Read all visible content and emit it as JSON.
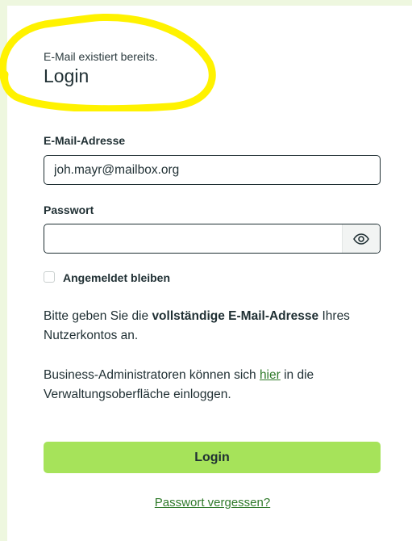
{
  "notice": "E-Mail existiert bereits.",
  "title": "Login",
  "email": {
    "label": "E-Mail-Adresse",
    "value": "joh.mayr@mailbox.org"
  },
  "password": {
    "label": "Passwort",
    "value": "",
    "toggle_icon": "eye-icon"
  },
  "remember": {
    "label": "Angemeldet bleiben",
    "checked": false
  },
  "info1": {
    "prefix": "Bitte geben Sie die ",
    "bold": "vollständige E-Mail-Adresse",
    "suffix": " Ihres Nutzerkontos an."
  },
  "info2": {
    "prefix": "Business-Administratoren können sich ",
    "link": "hier",
    "suffix": " in die Verwaltungsoberfläche einloggen."
  },
  "login_button": "Login",
  "forgot_link": "Passwort vergessen?",
  "colors": {
    "accent_button": "#a6e35a",
    "link": "#2f7a2a",
    "highlight": "#fff200",
    "page_background": "#eef7df"
  }
}
